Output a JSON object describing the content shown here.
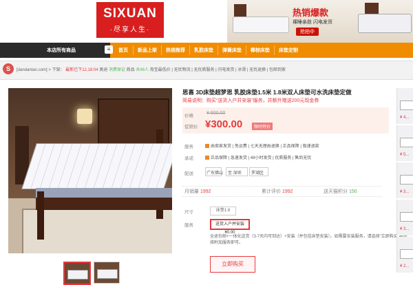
{
  "brand": {
    "name": "SIXUAN",
    "slogan": "·尽享人生·"
  },
  "banner": {
    "headline": "热销爆款",
    "subline": "裸睡亲肤  闪电发货",
    "cta": "抢拍中"
  },
  "nav": {
    "all_products": "本店所有商品",
    "badge": "≡",
    "items": [
      "首页",
      "新品上架",
      "热销推荐",
      "乳胶床垫",
      "弹簧床垫",
      "椰棕床垫",
      "床垫定制"
    ]
  },
  "breadcrumb": {
    "site": "[dandantan.com] > 下架：",
    "level": "最新已下12,18:04",
    "v1": "奥迪",
    "v2": "消费保证",
    "v3": "商品",
    "v4": "共48人",
    "rest": "淘宝最低价 | 无忧物流 | 无优质服务 | 闪电发货 | 冰滑 | 无忧退换 | 包邮到家"
  },
  "product": {
    "title": "思喜 3D床垫超梦思 乳胶床垫1.5米 1.8米双人床垫可水洗床垫定做",
    "subtitle": "简易说明：购买“送货入户并安装”服务，并额外赠送200元现金券",
    "orig_label": "价格",
    "orig_price": "¥ 600.00",
    "price_label": "促销价",
    "price": "¥300.00",
    "price_tag": "限时特价",
    "service_label": "服务",
    "service_line1": "由卖家发货 | 免运费 | 七天无理由退换 | 正品保障 | 极速退款",
    "guarantee_label": "承诺",
    "service_line2": "正品保障 | 急速发货 | 48小时发货 | 优质服务 | 售后无忧",
    "delivery_label": "配送",
    "delivery_from": "广东佛山",
    "delivery_to": "至 深圳",
    "delivery_area": "罗湖区",
    "stats": {
      "monthly_label": "月销量",
      "monthly_value": "1992",
      "reviews_label": "累计评价",
      "reviews_value": "1992",
      "points_label": "送天猫积分",
      "points_value": "150"
    },
    "size_label": "尺寸",
    "size_value": "床垫1.8",
    "svc_label": "服务",
    "svc_value": "送货入户并安装 ¥0.00",
    "description": "全途包邮+一体化送货（3-7天内可到达）+安装（并包括床垫安装）。如需要安装服务，请选择“立即购买”再选择附加服务即可。",
    "buy": "立即购买"
  },
  "side_prices": [
    "¥ 4...",
    "¥ 5...",
    "¥ 3...",
    "¥ 3...",
    "¥ 2...",
    "¥ 3..."
  ]
}
